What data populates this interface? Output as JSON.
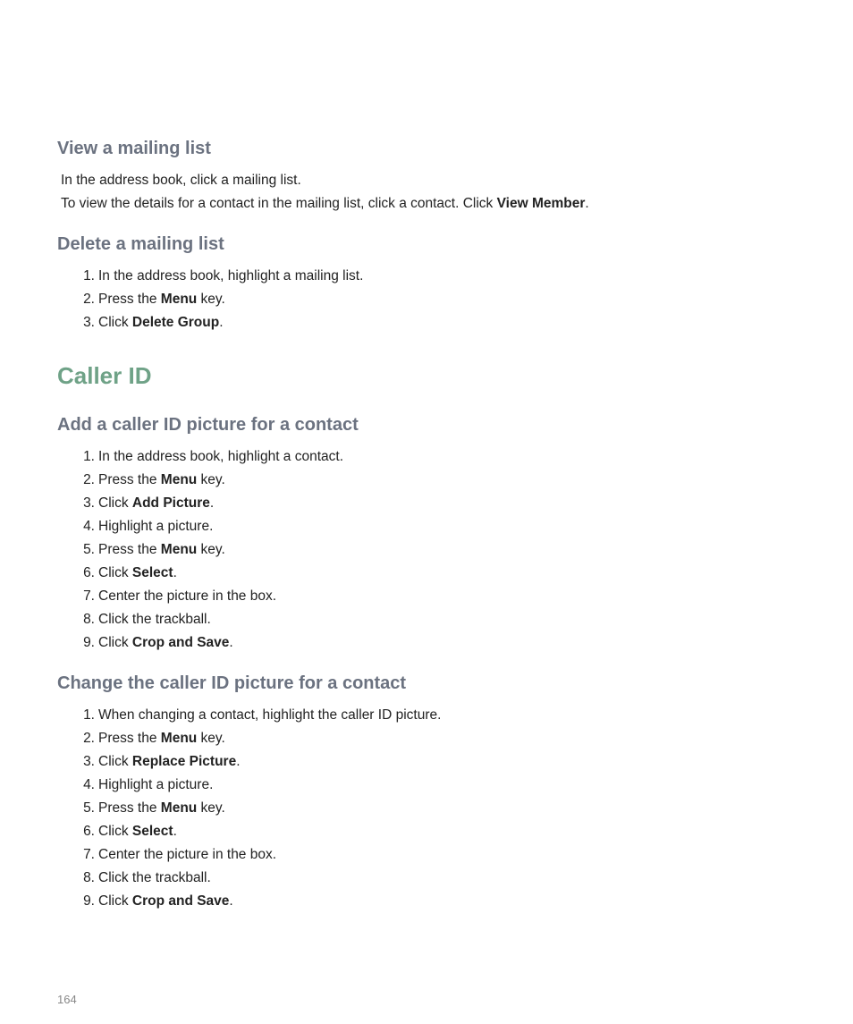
{
  "section1": {
    "heading": "View a mailing list",
    "para1": "In the address book, click a mailing list.",
    "para2_prefix": "To view the details for a contact in the mailing list, click a contact. Click ",
    "para2_bold": "View Member",
    "para2_suffix": "."
  },
  "section2": {
    "heading": "Delete a mailing list",
    "items": [
      {
        "num": "1.",
        "text": "In the address book, highlight a mailing list."
      },
      {
        "num": "2.",
        "prefix": "Press the ",
        "bold": "Menu",
        "suffix": " key."
      },
      {
        "num": "3.",
        "prefix": "Click ",
        "bold": "Delete Group",
        "suffix": "."
      }
    ]
  },
  "main_heading": "Caller ID",
  "section3": {
    "heading": "Add a caller ID picture for a contact",
    "items": [
      {
        "num": "1.",
        "text": "In the address book, highlight a contact."
      },
      {
        "num": "2.",
        "prefix": "Press the ",
        "bold": "Menu",
        "suffix": " key."
      },
      {
        "num": "3.",
        "prefix": "Click ",
        "bold": "Add Picture",
        "suffix": "."
      },
      {
        "num": "4.",
        "text": "Highlight a picture."
      },
      {
        "num": "5.",
        "prefix": "Press the ",
        "bold": "Menu",
        "suffix": " key."
      },
      {
        "num": "6.",
        "prefix": "Click ",
        "bold": "Select",
        "suffix": "."
      },
      {
        "num": "7.",
        "text": "Center the picture in the box."
      },
      {
        "num": "8.",
        "text": "Click the trackball."
      },
      {
        "num": "9.",
        "prefix": "Click ",
        "bold": "Crop and Save",
        "suffix": "."
      }
    ]
  },
  "section4": {
    "heading": "Change the caller ID picture for a contact",
    "items": [
      {
        "num": "1.",
        "text": "When changing a contact, highlight the caller ID picture."
      },
      {
        "num": "2.",
        "prefix": "Press the ",
        "bold": "Menu",
        "suffix": " key."
      },
      {
        "num": "3.",
        "prefix": "Click ",
        "bold": "Replace Picture",
        "suffix": "."
      },
      {
        "num": "4.",
        "text": "Highlight a picture."
      },
      {
        "num": "5.",
        "prefix": "Press the ",
        "bold": "Menu",
        "suffix": " key."
      },
      {
        "num": "6.",
        "prefix": "Click ",
        "bold": "Select",
        "suffix": "."
      },
      {
        "num": "7.",
        "text": "Center the picture in the box."
      },
      {
        "num": "8.",
        "text": "Click the trackball."
      },
      {
        "num": "9.",
        "prefix": "Click ",
        "bold": "Crop and Save",
        "suffix": "."
      }
    ]
  },
  "page_number": "164"
}
